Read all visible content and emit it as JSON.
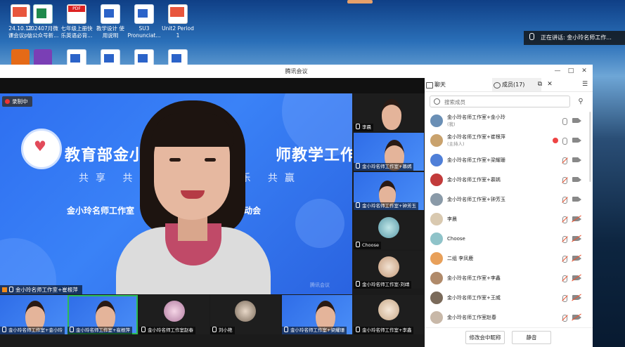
{
  "desktop": {
    "icons": [
      {
        "label": "24.10.12\n课会议p...",
        "type": "ppt"
      },
      {
        "label": "202407月微\n信公众号新...",
        "type": "xls"
      },
      {
        "label": "七年级上册快\n乐英语必背...",
        "type": "pdf"
      },
      {
        "label": "教学设计 使\n用说明",
        "type": "doc"
      },
      {
        "label": "SU3\nPronunciat...",
        "type": "doc"
      },
      {
        "label": "Unit2 Period\n1",
        "type": "ppt"
      }
    ],
    "speaking_prefix": "正在讲话:",
    "speaking_name": "金小玲名师工作..."
  },
  "window": {
    "title": "腾讯会议",
    "controls": {
      "min": "—",
      "max": "□",
      "close": "✕"
    }
  },
  "main_video": {
    "recording_label": "录制中",
    "banner_title_left": "教育部金小",
    "banner_title_right": "师教学工作室",
    "banner_sub_left": "共享  共融",
    "banner_sub_right": "乐  共赢",
    "banner_line_left": "金小玲名师工作室",
    "banner_line_right": "录课启动会",
    "speaker_name": "金小玲名师工作室+崔根萍",
    "watermark": "腾讯会议"
  },
  "side_tiles": [
    {
      "name": "李晨"
    },
    {
      "name": "金小玲名师工作室+慕嫣"
    },
    {
      "name": "金小玲名师工作室+钟芳玉"
    },
    {
      "name": "Choose"
    },
    {
      "name": "金小玲名师工作室-刘靖"
    }
  ],
  "bottom_tiles": [
    {
      "name": "金小玲名师工作室+金小玲"
    },
    {
      "name": "金小玲名师工作室+崔根萍"
    },
    {
      "name": "金小玲名师工作室赵春"
    },
    {
      "name": "刘小艳"
    },
    {
      "name": "金小玲名师工作室+梁耀珊"
    },
    {
      "name": "金小玲名师工作室+李鑫"
    }
  ],
  "panel": {
    "tab_chat": "聊天",
    "tab_members": "成员(17)",
    "search_placeholder": "搜索成员",
    "members": [
      {
        "name": "金小玲名师工作室+金小玲",
        "role": "(我)",
        "mic": "on",
        "cam": "on",
        "avatar": "#6a8fb5"
      },
      {
        "name": "金小玲名师工作室+崔根萍",
        "role": "(主持人)",
        "mic": "on",
        "cam": "on",
        "rec": true,
        "avatar": "#c9a26d"
      },
      {
        "name": "金小玲名师工作室+梁耀珊",
        "role": "",
        "mic": "off",
        "cam": "on",
        "avatar": "#4f7fd8"
      },
      {
        "name": "金小玲名师工作室+慕嫣",
        "role": "",
        "mic": "off",
        "cam": "on",
        "avatar": "#c23b3b"
      },
      {
        "name": "金小玲名师工作室+钟芳玉",
        "role": "",
        "mic": "off",
        "cam": "on",
        "avatar": "#8a9aa8"
      },
      {
        "name": "李晨",
        "role": "",
        "mic": "off",
        "cam": "off",
        "avatar": "#d9c9b0"
      },
      {
        "name": "Choose",
        "role": "",
        "mic": "off",
        "cam": "off",
        "avatar": "#8fc3c9"
      },
      {
        "name": "二组 李凤鹿",
        "role": "",
        "mic": "off",
        "cam": "off",
        "avatar": "#e8a05a"
      },
      {
        "name": "金小玲名师工作室+李鑫",
        "role": "",
        "mic": "off",
        "cam": "off",
        "avatar": "#b08a6a"
      },
      {
        "name": "金小玲名师工作室+王威",
        "role": "",
        "mic": "off",
        "cam": "off",
        "avatar": "#7a6a5a"
      },
      {
        "name": "金小玲名师工作室赵春",
        "role": "",
        "mic": "off",
        "cam": "off",
        "avatar": "#c8b8a8"
      }
    ],
    "btn_rename": "修改会中昵称",
    "btn_mute": "静音"
  }
}
